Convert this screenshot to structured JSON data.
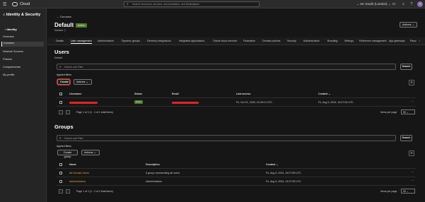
{
  "topbar": {
    "brand": "Cloud",
    "search_placeholder": "Search resources, services, documentation, and Marketplace",
    "region": "UK South (London)",
    "avatar": "A"
  },
  "sidebar": {
    "title": "Identity & Security",
    "back": "Identity",
    "items": [
      "Overview",
      "Domains",
      "Network Sources",
      "Policies",
      "Compartments",
      "My profile"
    ]
  },
  "header": {
    "breadcrumb": "Domains",
    "title": "Default",
    "badge": "Active",
    "domain_type": "Domain",
    "actions": "Actions"
  },
  "tabs": [
    "Details",
    "User management",
    "Administrators",
    "Dynamic groups",
    "Directory integrations",
    "Integrated applications",
    "Oracle cloud services",
    "Federation",
    "Domain policies",
    "Security",
    "Authentication",
    "Branding",
    "Settings",
    "Reference management",
    "App gateways",
    "Repo"
  ],
  "users": {
    "title": "Users",
    "subtitle": "Default",
    "search_placeholder": "Search and Filter",
    "search_btn": "Search",
    "applied": "Applied filters",
    "create": "Create",
    "actions": "Actions",
    "columns": {
      "username": "Username",
      "status": "Status",
      "email": "Email",
      "last_access": "Last access",
      "created": "Created"
    },
    "row": {
      "status": "Active",
      "last_access": "Fri, Oct 31, 2025, 10:45:13 UTC",
      "created": "Fri, Aug 9, 2024, 15:27:04 UTC"
    },
    "pager": "Page 1 of 1 (1 - 1 of 1 total items)",
    "per_page_label": "Items per page",
    "per_page": "50"
  },
  "groups": {
    "title": "Groups",
    "search_placeholder": "Search and Filter",
    "search_btn": "Search",
    "applied": "Applied filters",
    "create": "Create group",
    "actions": "Actions",
    "columns": {
      "name": "Name",
      "description": "Description",
      "created": "Created"
    },
    "rows": [
      {
        "name": "All Domain Users",
        "description": "A group representing all users.",
        "created": "Fri, Aug 9, 2024, 15:27:59 UTC"
      },
      {
        "name": "Administrators",
        "description": "Administrators",
        "created": "Fri, Aug 9, 2024, 15:27:05 UTC"
      }
    ],
    "pager": "Page 1 of 1 (1 - 2 of 2 total items)",
    "per_page_label": "Items per page",
    "per_page": "50"
  }
}
